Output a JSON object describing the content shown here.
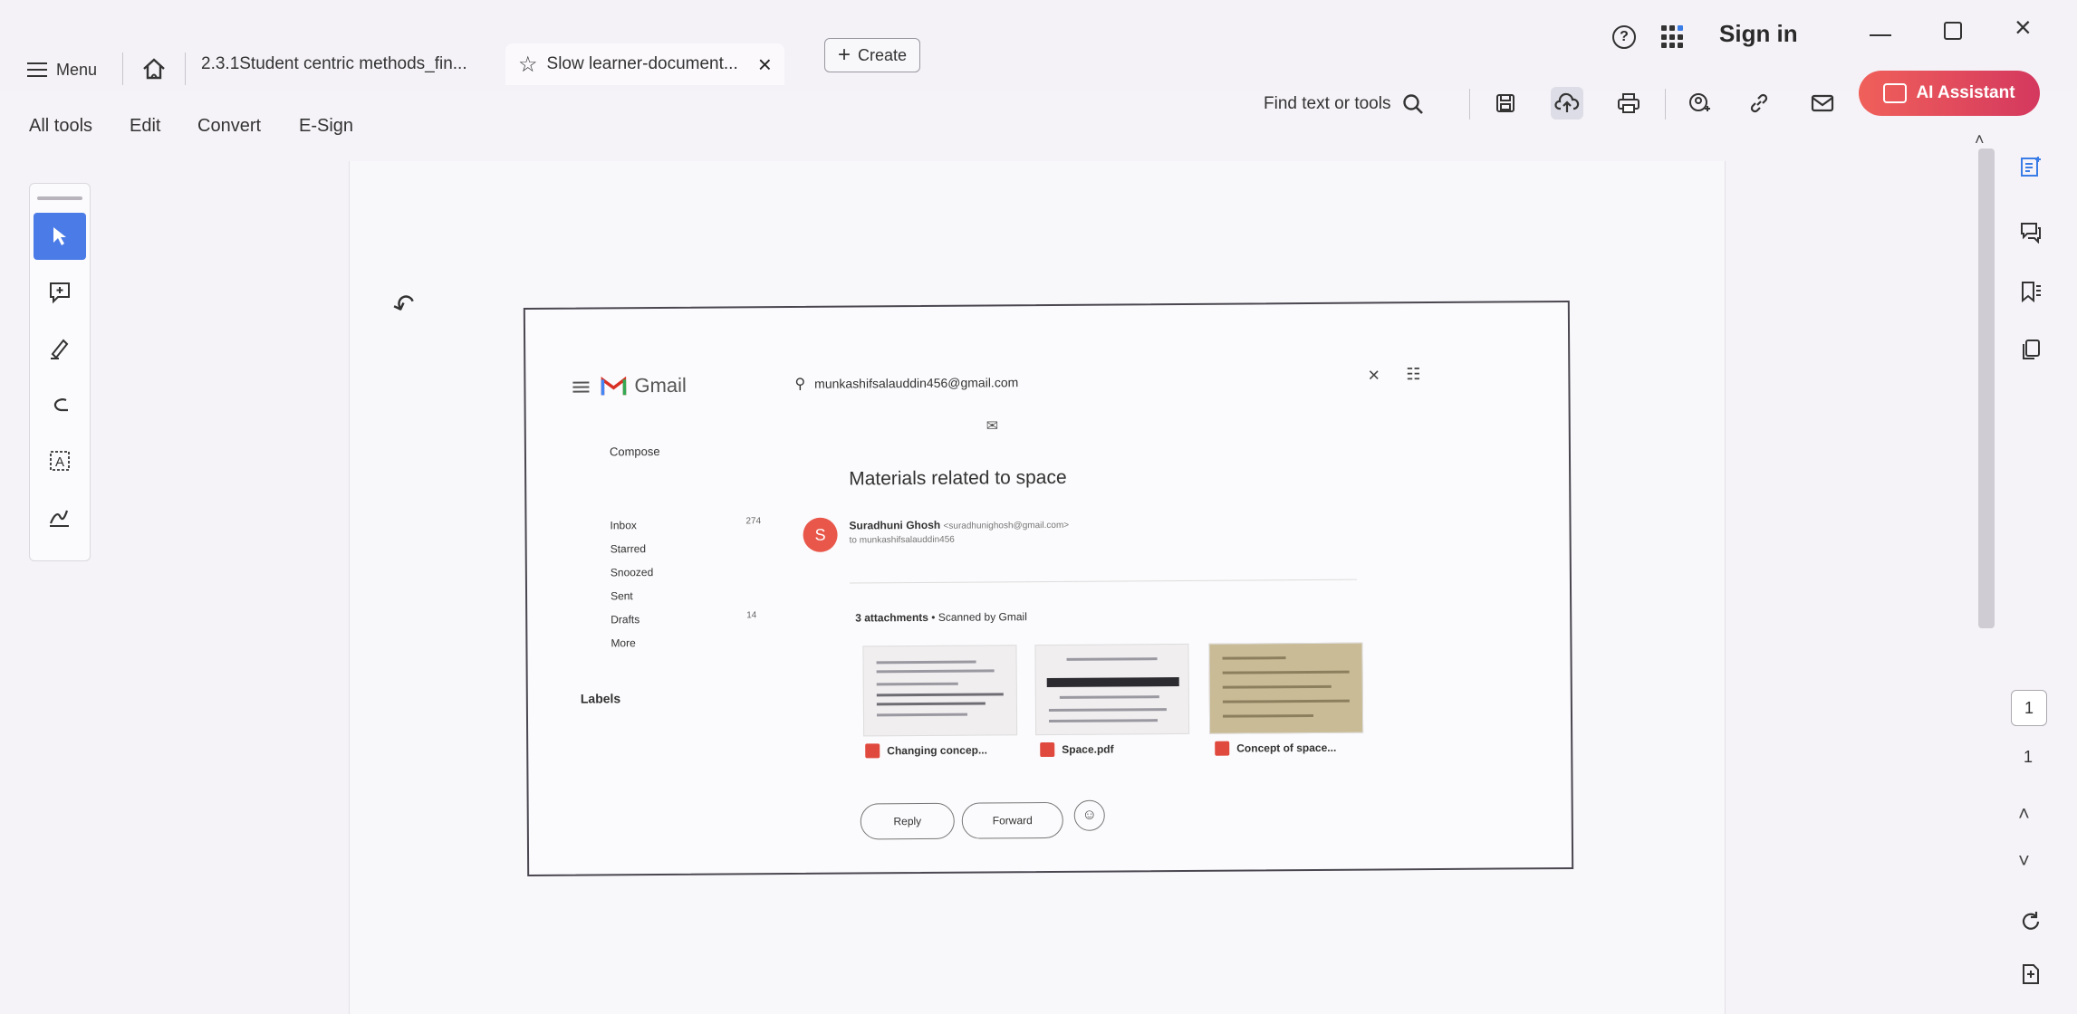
{
  "titlebar": {
    "menu_label": "Menu",
    "tabs": [
      {
        "label": "2.3.1Student centric methods_fin..."
      },
      {
        "label": "Slow learner-document..."
      }
    ],
    "create_label": "Create",
    "signin_label": "Sign in"
  },
  "toolbar": {
    "menus": [
      "All tools",
      "Edit",
      "Convert",
      "E-Sign"
    ],
    "find_label": "Find text or tools",
    "ai_label": "AI Assistant"
  },
  "gmail": {
    "brand": "Gmail",
    "search_query": "munkashifsalauddin456@gmail.com",
    "compose": "Compose",
    "nav": [
      {
        "label": "Inbox",
        "count": "274"
      },
      {
        "label": "Starred",
        "count": ""
      },
      {
        "label": "Snoozed",
        "count": ""
      },
      {
        "label": "Sent",
        "count": ""
      },
      {
        "label": "Drafts",
        "count": "14"
      },
      {
        "label": "More",
        "count": ""
      }
    ],
    "labels_heading": "Labels",
    "subject": "Materials related to space",
    "sender_initial": "S",
    "sender_name": "Suradhuni Ghosh",
    "sender_email": "<suradhunighosh@gmail.com>",
    "to_line": "to munkashifsalauddin456",
    "attachments_count": "3 attachments",
    "attachments_note": " • Scanned by Gmail",
    "files": [
      {
        "name": "Changing concep..."
      },
      {
        "name": "Space.pdf"
      },
      {
        "name": "Concept of space..."
      }
    ],
    "reply_label": "Reply",
    "forward_label": "Forward"
  },
  "pager": {
    "current": "1",
    "total": "1"
  },
  "colors": {
    "ai_gradient_start": "#f0605a",
    "ai_gradient_end": "#d4385e",
    "active_tool": "#4b7be6",
    "gmail_avatar": "#e8574a"
  }
}
